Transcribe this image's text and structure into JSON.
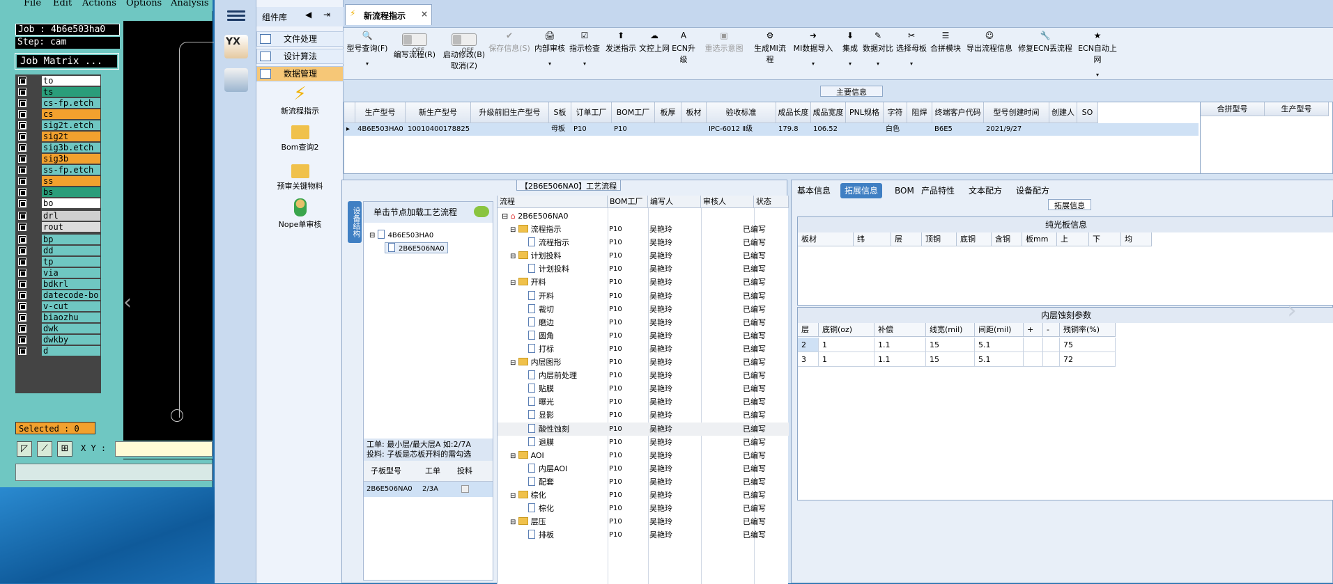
{
  "cam": {
    "menu": [
      "File",
      "Edit",
      "Actions",
      "Options",
      "Analysis"
    ],
    "job": "Job : 4b6e503ha0",
    "step": "Step: cam",
    "matrix_btn": "Job Matrix ...",
    "layers": [
      {
        "name": "to",
        "color": "#ffffff"
      },
      {
        "name": "ts",
        "color": "#2a9d7a"
      },
      {
        "name": "cs-fp.etch",
        "color": "#6fc7c2"
      },
      {
        "name": "cs",
        "color": "#f2a12e"
      },
      {
        "name": "sig2t.etch",
        "color": "#6fc7c2"
      },
      {
        "name": "sig2t",
        "color": "#f2a12e"
      },
      {
        "name": "sig3b.etch",
        "color": "#6fc7c2"
      },
      {
        "name": "sig3b",
        "color": "#f2a12e"
      },
      {
        "name": "ss-fp.etch",
        "color": "#6fc7c2"
      },
      {
        "name": "ss",
        "color": "#f2a12e"
      },
      {
        "name": "bs",
        "color": "#2a9d7a"
      },
      {
        "name": "bo",
        "color": "#ffffff"
      },
      {
        "name": "drl",
        "color": "#cfcfcf"
      },
      {
        "name": "rout",
        "color": "#dcdcdc"
      },
      {
        "name": "bp",
        "color": "#6fc7c2"
      },
      {
        "name": "dd",
        "color": "#6fc7c2"
      },
      {
        "name": "tp",
        "color": "#6fc7c2"
      },
      {
        "name": "via",
        "color": "#6fc7c2"
      },
      {
        "name": "bdkrl",
        "color": "#6fc7c2"
      },
      {
        "name": "datecode-bo",
        "color": "#6fc7c2"
      },
      {
        "name": "v-cut",
        "color": "#6fc7c2"
      },
      {
        "name": "biaozhu",
        "color": "#6fc7c2"
      },
      {
        "name": "dwk",
        "color": "#6fc7c2"
      },
      {
        "name": "dwkby",
        "color": "#6fc7c2"
      },
      {
        "name": "d",
        "color": "#6fc7c2"
      }
    ],
    "selected": "Selected : 0",
    "xy_label": "X Y :"
  },
  "sidebar": {
    "header": "组件库",
    "items": [
      "文件处理",
      "设计算法",
      "数据管理"
    ],
    "tools": [
      "新流程指示",
      "Bom查询2",
      "预审关键物料",
      "Nope单审核"
    ]
  },
  "tab": {
    "title": "新流程指示",
    "close": "×"
  },
  "ribbon": [
    {
      "icon": "🔍",
      "label": "型号查询(F)",
      "dd": "▾"
    },
    {
      "toggle": "OFF",
      "label": "编写流程(R)"
    },
    {
      "toggle": "OFF",
      "label": "启动修改(B)",
      "label2": "取消(Z)"
    },
    {
      "icon": "✔",
      "label": "保存信息(S)",
      "disabled": true
    },
    {
      "icon": "🖨",
      "label": "内部审核",
      "dd": "▾"
    },
    {
      "icon": "☑",
      "label": "指示检查",
      "dd": "▾"
    },
    {
      "icon": "⬆",
      "label": "发送指示"
    },
    {
      "icon": "☁",
      "label": "文控上网"
    },
    {
      "icon": "A",
      "label": "ECN升级"
    },
    {
      "icon": "▣",
      "label": "重选示意图",
      "disabled": true
    },
    {
      "icon": "⚙",
      "label": "生成MI流程"
    },
    {
      "icon": "➜",
      "label": "MI数据导入",
      "dd": "▾"
    },
    {
      "icon": "⬇",
      "label": "集成",
      "dd": "▾"
    },
    {
      "icon": "✎",
      "label": "数据对比",
      "dd": "▾"
    },
    {
      "icon": "✂",
      "label": "选择母板",
      "dd": "▾"
    },
    {
      "icon": "☰",
      "label": "合拼模块"
    },
    {
      "icon": "☺",
      "label": "导出流程信息"
    },
    {
      "icon": "🔧",
      "label": "修复ECN丢流程"
    },
    {
      "icon": "★",
      "label": "ECN自动上网",
      "dd": "▾"
    }
  ],
  "main_info": {
    "title": "主要信息",
    "columns": [
      "生产型号",
      "新生产型号",
      "升级前旧生产型号",
      "S板",
      "订单工厂",
      "BOM工厂",
      "板厚",
      "板材",
      "验收标准",
      "成品长度",
      "成品宽度",
      "PNL规格",
      "字符",
      "阻焊",
      "终端客户代码",
      "型号创建时间",
      "创建人",
      "SO"
    ],
    "row": [
      "4B6E503HA0",
      "10010400178825",
      "",
      "母板",
      "P10",
      "P10",
      "",
      "",
      "IPC-6012 Ⅱ级",
      "179.8",
      "106.52",
      "",
      "白色",
      "",
      "B6E5",
      "2021/9/27",
      "",
      ""
    ],
    "side_columns": [
      "合拼型号",
      "生产型号"
    ]
  },
  "process": {
    "title": "【2B6E506NA0】工艺流程",
    "side_tab": "设备结构",
    "load_hint": "单击节点加载工艺流程",
    "tree": [
      "4B6E503HA0",
      "2B6E506NA0"
    ],
    "note1": "工单: 最小层/最大层A 如:2/7A",
    "note2": "投料: 子板是芯板开料的需勾选",
    "sub_cols": [
      "子板型号",
      "工单",
      "投料"
    ],
    "sub_row": [
      "2B6E506NA0",
      "2/3A"
    ],
    "cols": [
      "流程",
      "BOM工厂",
      "编写人",
      "审核人",
      "状态"
    ],
    "root": "2B6E506NA0",
    "rows": [
      {
        "n": "流程指示",
        "lvl": 1,
        "b": "P10",
        "a": "吴艳玲",
        "s": "已编写"
      },
      {
        "n": "流程指示",
        "lvl": 2,
        "b": "P10",
        "a": "吴艳玲",
        "s": "已编写"
      },
      {
        "n": "计划投料",
        "lvl": 1,
        "b": "P10",
        "a": "吴艳玲",
        "s": "已编写"
      },
      {
        "n": "计划投料",
        "lvl": 2,
        "b": "P10",
        "a": "吴艳玲",
        "s": "已编写"
      },
      {
        "n": "开料",
        "lvl": 1,
        "b": "P10",
        "a": "吴艳玲",
        "s": "已编写"
      },
      {
        "n": "开料",
        "lvl": 2,
        "b": "P10",
        "a": "吴艳玲",
        "s": "已编写"
      },
      {
        "n": "裁切",
        "lvl": 2,
        "b": "P10",
        "a": "吴艳玲",
        "s": "已编写"
      },
      {
        "n": "磨边",
        "lvl": 2,
        "b": "P10",
        "a": "吴艳玲",
        "s": "已编写"
      },
      {
        "n": "圆角",
        "lvl": 2,
        "b": "P10",
        "a": "吴艳玲",
        "s": "已编写"
      },
      {
        "n": "打标",
        "lvl": 2,
        "b": "P10",
        "a": "吴艳玲",
        "s": "已编写"
      },
      {
        "n": "内层图形",
        "lvl": 1,
        "b": "P10",
        "a": "吴艳玲",
        "s": "已编写"
      },
      {
        "n": "内层前处理",
        "lvl": 2,
        "b": "P10",
        "a": "吴艳玲",
        "s": "已编写"
      },
      {
        "n": "贴膜",
        "lvl": 2,
        "b": "P10",
        "a": "吴艳玲",
        "s": "已编写"
      },
      {
        "n": "曝光",
        "lvl": 2,
        "b": "P10",
        "a": "吴艳玲",
        "s": "已编写"
      },
      {
        "n": "显影",
        "lvl": 2,
        "b": "P10",
        "a": "吴艳玲",
        "s": "已编写"
      },
      {
        "n": "酸性蚀刻",
        "lvl": 2,
        "b": "P10",
        "a": "吴艳玲",
        "s": "已编写",
        "sel": true
      },
      {
        "n": "退膜",
        "lvl": 2,
        "b": "P10",
        "a": "吴艳玲",
        "s": "已编写"
      },
      {
        "n": "AOI",
        "lvl": 1,
        "b": "P10",
        "a": "吴艳玲",
        "s": "已编写"
      },
      {
        "n": "内层AOI",
        "lvl": 2,
        "b": "P10",
        "a": "吴艳玲",
        "s": "已编写"
      },
      {
        "n": "配套",
        "lvl": 2,
        "b": "P10",
        "a": "吴艳玲",
        "s": "已编写"
      },
      {
        "n": "棕化",
        "lvl": 1,
        "b": "P10",
        "a": "吴艳玲",
        "s": "已编写"
      },
      {
        "n": "棕化",
        "lvl": 2,
        "b": "P10",
        "a": "吴艳玲",
        "s": "已编写"
      },
      {
        "n": "层压",
        "lvl": 1,
        "b": "P10",
        "a": "吴艳玲",
        "s": "已编写"
      },
      {
        "n": "排板",
        "lvl": 2,
        "b": "P10",
        "a": "吴艳玲",
        "s": "已编写"
      }
    ]
  },
  "right": {
    "tabs": [
      "基本信息",
      "拓展信息",
      "BOM",
      "产品特性",
      "文本配方",
      "设备配方"
    ],
    "active_tab": "拓展信息",
    "ext_title": "拓展信息",
    "bare_title": "纯光板信息",
    "bare_cols": [
      "板材",
      "纬",
      "层",
      "顶铜",
      "底铜",
      "含铜",
      "板mm",
      "上",
      "下",
      "均"
    ],
    "inner_title": "内层蚀刻参数",
    "inner_cols": [
      "层",
      "底铜(oz)",
      "补偿",
      "线宽(mil)",
      "间距(mil)",
      "+",
      "-",
      "残铜率(%)"
    ],
    "inner_rows": [
      [
        "2",
        "1",
        "1.1",
        "15",
        "5.1",
        "",
        "",
        "75"
      ],
      [
        "3",
        "1",
        "1.1",
        "15",
        "5.1",
        "",
        "",
        "72"
      ]
    ]
  }
}
